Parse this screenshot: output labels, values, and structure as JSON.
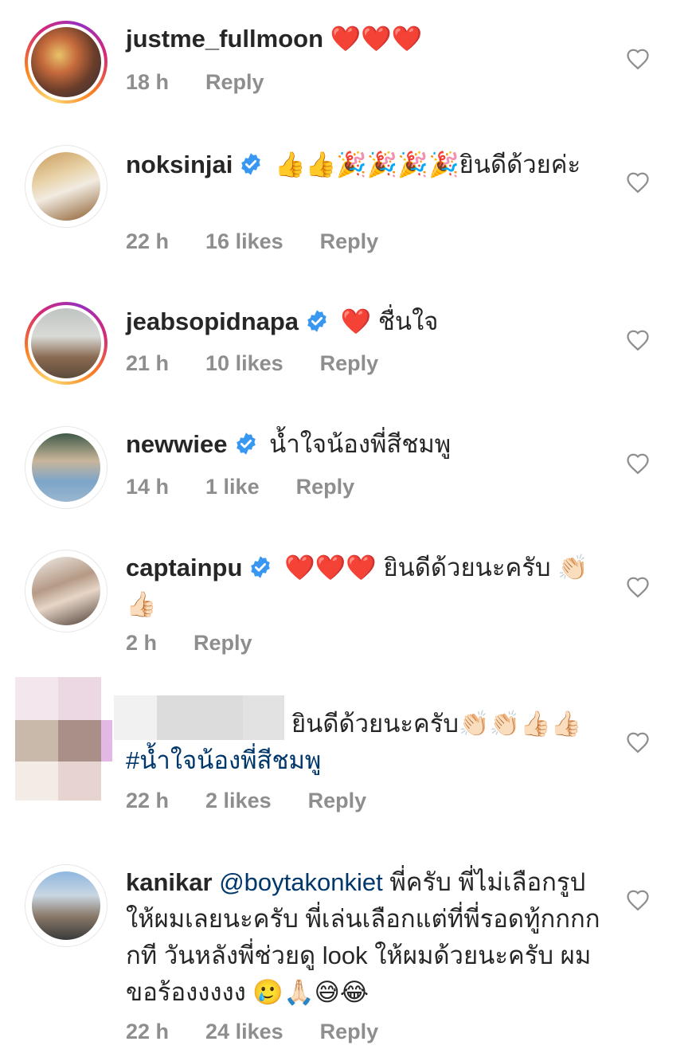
{
  "comments": [
    {
      "username": "justme_fullmoon",
      "verified": false,
      "text": "❤️❤️❤️",
      "time": "18 h",
      "likes": "",
      "reply": "Reply"
    },
    {
      "username": "noksinjai",
      "verified": true,
      "text": "👍👍🎉🎉🎉🎉ยินดีด้วยค่ะ",
      "time": "22 h",
      "likes": "16 likes",
      "reply": "Reply"
    },
    {
      "username": "jeabsopidnapa",
      "verified": true,
      "text": "❤️ ชื่นใจ",
      "time": "21 h",
      "likes": "10 likes",
      "reply": "Reply"
    },
    {
      "username": "newwiee",
      "verified": true,
      "text": "น้ำใจน้องพี่สีชมพู",
      "time": "14 h",
      "likes": "1 like",
      "reply": "Reply"
    },
    {
      "username": "captainpu",
      "verified": true,
      "text": "❤️❤️❤️ ยินดีด้วยนะครับ 👏🏻👍🏻",
      "time": "2 h",
      "likes": "",
      "reply": "Reply"
    },
    {
      "username": "",
      "verified": false,
      "text": "ยินดีด้วยนะครับ👏🏻👏🏻👍🏻👍🏻",
      "hashtag": "#น้ำใจน้องพี่สีชมพู",
      "time": "22 h",
      "likes": "2 likes",
      "reply": "Reply"
    },
    {
      "username": "kanikar",
      "verified": false,
      "mention": "@boytakonkiet",
      "text": "พี่ครับ พี่ไม่เลือกรูปให้ผมเลยนะครับ พี่เล่นเลือกแต่ที่พี่รอดทู้กกกกกที วันหลังพี่ช่วยดู look ให้ผมด้วยนะครับ ผมขอร้องงงงง 🥲🙏🏻😅😂",
      "time": "22 h",
      "likes": "24 likes",
      "reply": "Reply"
    }
  ],
  "icons": {
    "like": "heart-outline-icon",
    "verified": "verified-badge-icon"
  },
  "colors": {
    "text": "#262626",
    "meta": "#8e8e8e",
    "link": "#00376b",
    "verified": "#3897f0"
  }
}
